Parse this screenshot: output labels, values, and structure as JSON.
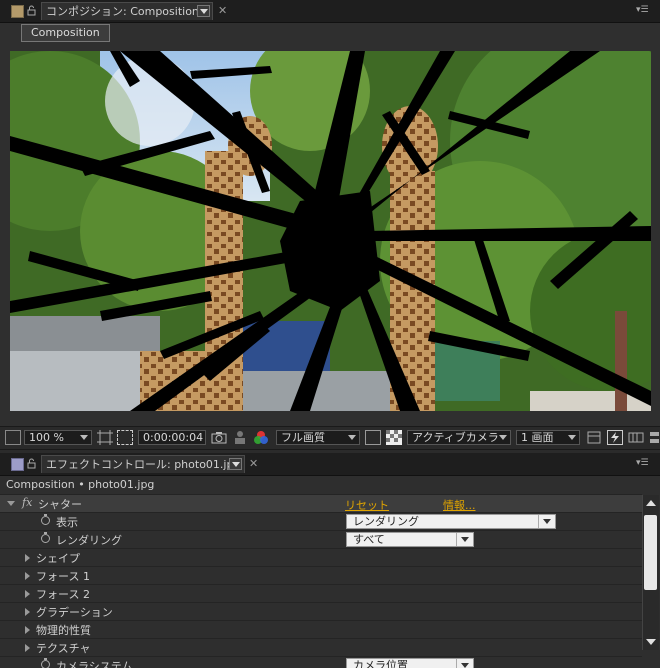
{
  "comp_panel": {
    "tab_label": "コンポジション: Composition",
    "button_label": "Composition"
  },
  "viewer_toolbar": {
    "zoom": "100 %",
    "timecode": "0:00:00:04",
    "resolution": "フル画質",
    "camera": "アクティブカメラ",
    "view_layout": "1 画面"
  },
  "effect_panel": {
    "tab_label": "エフェクトコントロール: photo01.jpg",
    "title": "Composition • photo01.jpg",
    "fx_icon": "fx",
    "effect_name": "シャター",
    "reset_link": "リセット",
    "info_link": "情報...",
    "props": {
      "display_label": "表示",
      "display_value": "レンダリング",
      "render_label": "レンダリング",
      "render_value": "すべて",
      "shape": "シェイプ",
      "force1": "フォース 1",
      "force2": "フォース 2",
      "gradient": "グラデーション",
      "physics": "物理的性質",
      "texture": "テクスチャ",
      "camera_system_label": "カメラシステム",
      "camera_system_value": "カメラ位置"
    }
  },
  "colors": {
    "link": "#e0a400",
    "panel_bg": "#2e2e2e",
    "header_bg": "#1e1e1e"
  }
}
